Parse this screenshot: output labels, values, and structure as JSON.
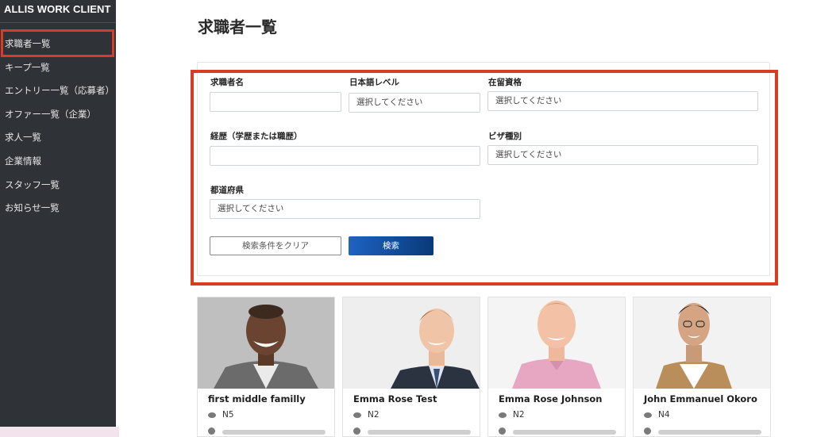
{
  "sidebar": {
    "brand": "ALLIS WORK CLIENT",
    "items": [
      {
        "label": "求職者一覧"
      },
      {
        "label": "キープ一覧"
      },
      {
        "label": "エントリー一覧（応募者）"
      },
      {
        "label": "オファー一覧（企業）"
      },
      {
        "label": "求人一覧"
      },
      {
        "label": "企業情報"
      },
      {
        "label": "スタッフ一覧"
      },
      {
        "label": "お知らせ一覧"
      }
    ]
  },
  "page": {
    "title": "求職者一覧"
  },
  "search_form": {
    "name_label": "求職者名",
    "name_value": "",
    "japanese_level_label": "日本語レベル",
    "japanese_level_value": "選択してください",
    "residence_status_label": "在留資格",
    "residence_status_value": "選択してください",
    "history_label": "経歴（学歴または職歴）",
    "history_value": "",
    "visa_type_label": "ビザ種別",
    "visa_type_value": "選択してください",
    "prefecture_label": "都道府県",
    "prefecture_value": "選択してください",
    "clear_button": "検索条件をクリア",
    "search_button": "検索"
  },
  "candidates": [
    {
      "name": "first middle familly",
      "level": "N5"
    },
    {
      "name": "Emma Rose Test",
      "level": "N2"
    },
    {
      "name": "Emma Rose Johnson",
      "level": "N2"
    },
    {
      "name": "John Emmanuel Okoro",
      "level": "N4"
    }
  ],
  "colors": {
    "sidebar_bg": "#2f3337",
    "highlight": "#d83c22",
    "primary_button": "#0b4a9a"
  }
}
